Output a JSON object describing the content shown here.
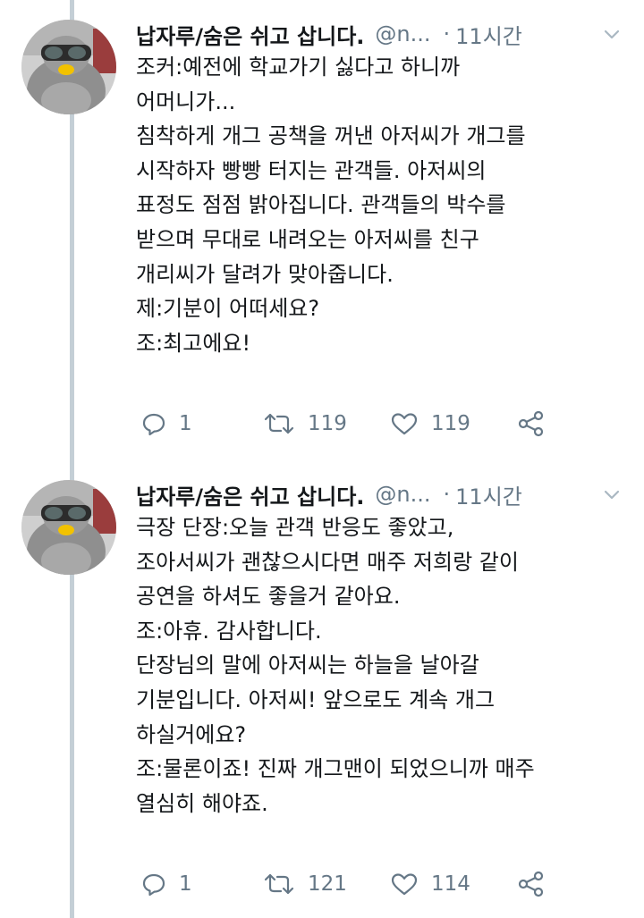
{
  "tweets": [
    {
      "display_name": "납자루/숨은 쉬고 삽니다.",
      "handle": "@n...",
      "separator": "·",
      "time": "11시간",
      "lines": [
        "조커:예전에 학교가기 싫다고 하니까",
        "어머니가...",
        "침착하게 개그 공책을 꺼낸 아저씨가 개그를",
        "시작하자 빵빵 터지는 관객들. 아저씨의",
        "표정도 점점 밝아집니다. 관객들의 박수를",
        "받으며 무대로 내려오는 아저씨를 친구",
        "개리씨가 달려가 맞아줍니다.",
        "제:기분이 어떠세요?",
        "조:최고에요!"
      ],
      "replies": "1",
      "retweets": "119",
      "likes": "119"
    },
    {
      "display_name": "납자루/숨은 쉬고 삽니다.",
      "handle": "@n...",
      "separator": "·",
      "time": "11시간",
      "lines": [
        "극장 단장:오늘 관객 반응도 좋았고,",
        "조아서씨가 괜찮으시다면 매주 저희랑 같이",
        "공연을 하셔도 좋을거 같아요.",
        "조:아휴. 감사합니다.",
        "단장님의 말에 아저씨는 하늘을 날아갈",
        "기분입니다. 아저씨! 앞으로도 계속 개그",
        "하실거에요?",
        "조:물론이죠! 진짜 개그맨이 되었으니까 매주",
        "열심히 해야죠."
      ],
      "replies": "1",
      "retweets": "121",
      "likes": "114"
    }
  ],
  "colors": {
    "text": "#14171a",
    "secondary": "#657786",
    "thread_line": "#c4cfd6",
    "background": "#ffffff"
  },
  "icons": {
    "reply": "reply-icon",
    "retweet": "retweet-icon",
    "like": "heart-icon",
    "share": "share-icon",
    "menu": "chevron-down-icon"
  }
}
